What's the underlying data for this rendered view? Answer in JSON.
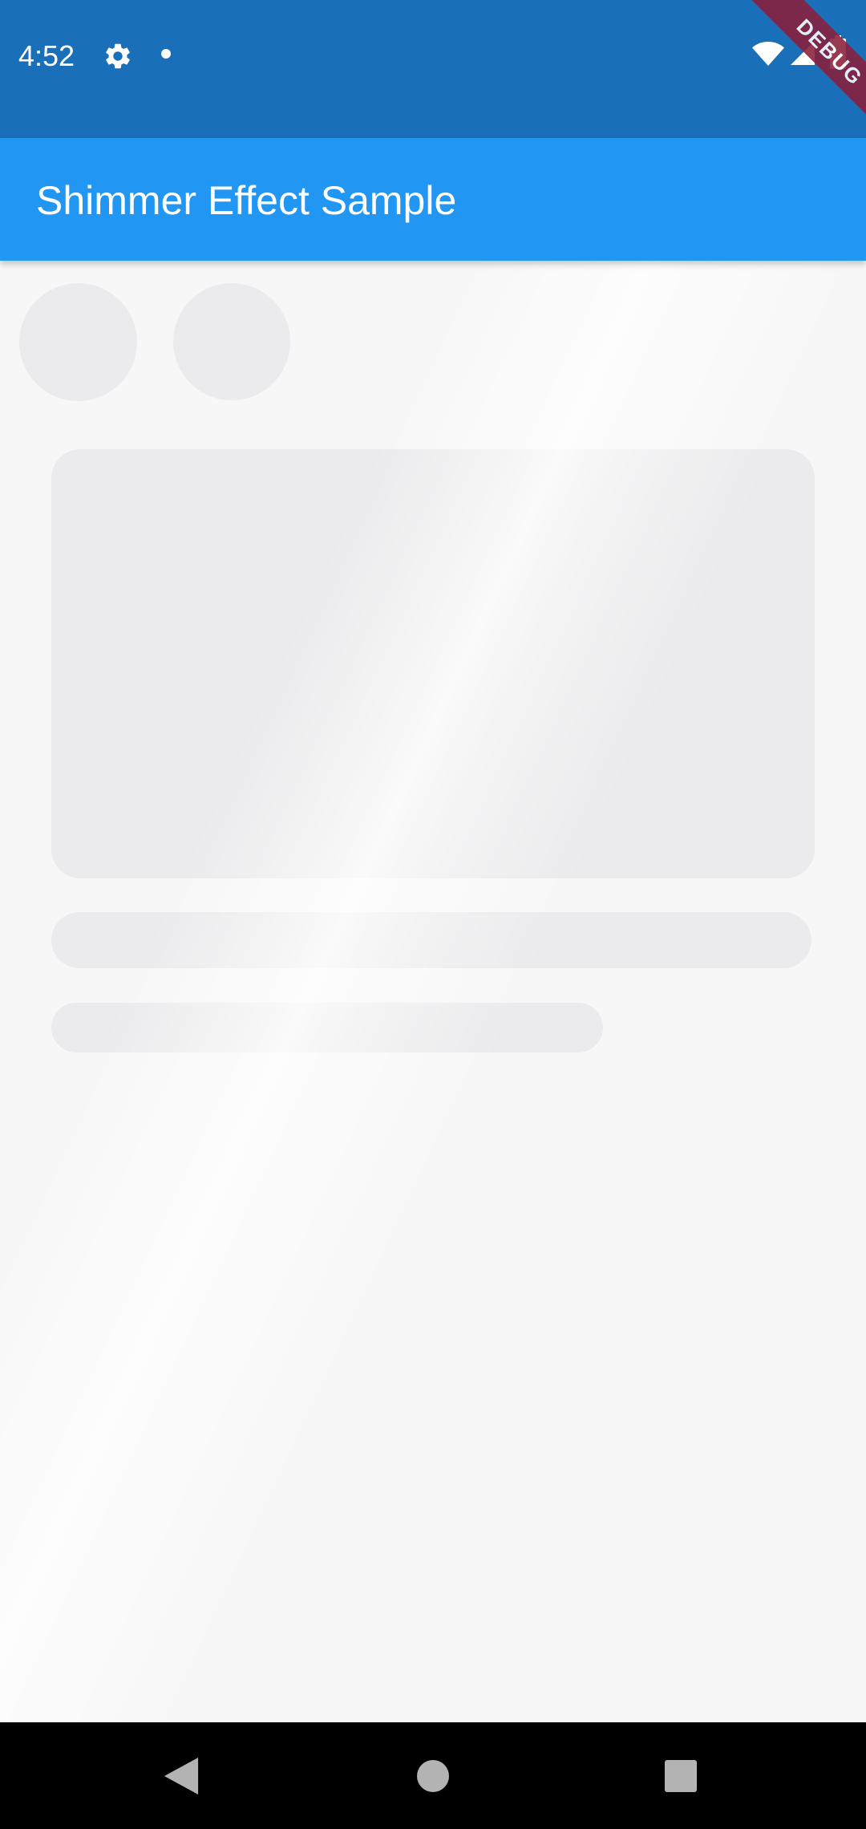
{
  "status_bar": {
    "time": "4:52",
    "icons": [
      "gear-icon",
      "notification-dot-icon",
      "wifi-icon",
      "signal-icon",
      "battery-icon"
    ],
    "color": "#1a6fb9"
  },
  "debug_banner": {
    "label": "DEBUG",
    "color": "#8a1f3b"
  },
  "app_bar": {
    "title": "Shimmer Effect Sample",
    "color": "#2196f3"
  },
  "content": {
    "placeholders": [
      "avatar-placeholder",
      "avatar-placeholder",
      "card-placeholder",
      "text-line-placeholder",
      "text-line-placeholder"
    ],
    "placeholder_color": "#ebebed"
  },
  "nav_bar": {
    "icons": [
      "back-icon",
      "home-icon",
      "recents-icon"
    ]
  }
}
